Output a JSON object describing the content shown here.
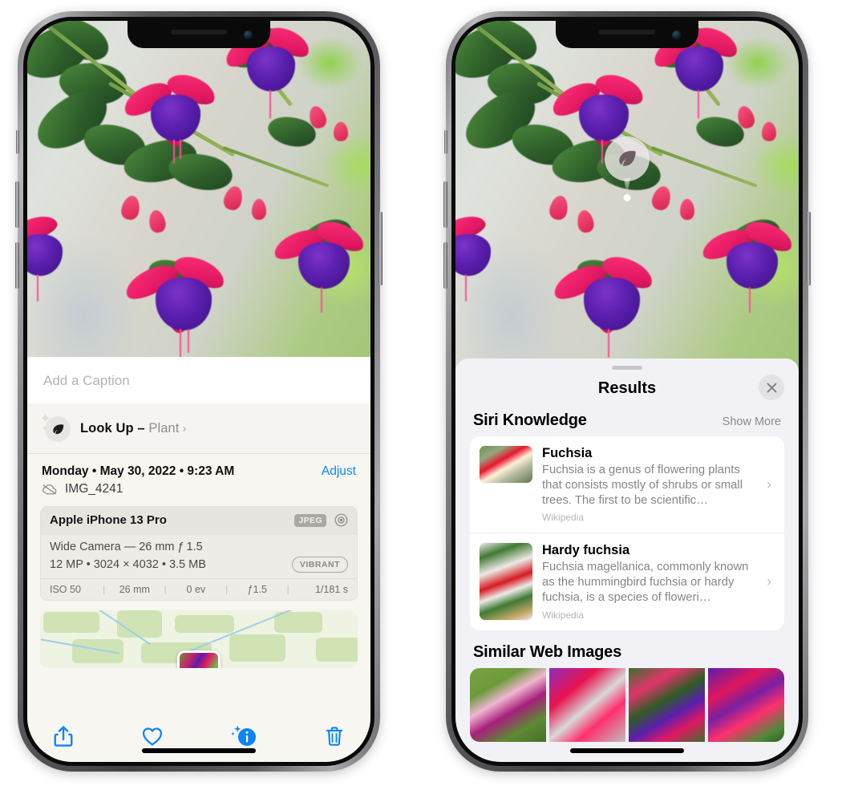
{
  "left_phone": {
    "caption_placeholder": "Add a Caption",
    "lookup": {
      "label": "Look Up",
      "dash": " – ",
      "subject": "Plant",
      "chevron": "›",
      "icon": "leaf-icon",
      "sparkle": "✦"
    },
    "date_line": "Monday • May 30, 2022 • 9:23 AM",
    "adjust_label": "Adjust",
    "file_name": "IMG_4241",
    "cloud_icon": "icloud-slash-icon",
    "exif": {
      "device": "Apple iPhone 13 Pro",
      "format_badge": "JPEG",
      "aperture_icon": "aperture-icon",
      "lens_line": "Wide Camera — 26 mm ƒ 1.5",
      "size_line": "12 MP • 3024 × 4032 • 3.5 MB",
      "style_badge": "VIBRANT",
      "stats": [
        "ISO 50",
        "26 mm",
        "0 ev",
        "ƒ1.5",
        "1/181 s"
      ],
      "divider": "|"
    },
    "map": {
      "name": "location-map-thumbnail"
    },
    "toolbar": [
      {
        "name": "share-button",
        "icon": "share-icon"
      },
      {
        "name": "favorite-button",
        "icon": "heart-icon"
      },
      {
        "name": "info-button",
        "icon": "info-sparkle-icon"
      },
      {
        "name": "delete-button",
        "icon": "trash-icon"
      }
    ],
    "accent_color": "#0a84ff"
  },
  "right_phone": {
    "vlu_badge": {
      "icon": "leaf-icon",
      "name": "visual-look-up-badge"
    },
    "sheet": {
      "title": "Results",
      "close_icon": "close-icon",
      "sections": [
        {
          "title": "Siri Knowledge",
          "action": "Show More",
          "cards": [
            {
              "title": "Fuchsia",
              "description": "Fuchsia is a genus of flowering plants that consists mostly of shrubs or small trees. The first to be scientific…",
              "source": "Wikipedia",
              "thumb": "fuchsia-red-flowers-thumbnail"
            },
            {
              "title": "Hardy fuchsia",
              "description": "Fuchsia magellanica, commonly known as the hummingbird fuchsia or hardy fuchsia, is a species of floweri…",
              "source": "Wikipedia",
              "thumb": "hardy-fuchsia-specimen-thumbnail"
            }
          ]
        },
        {
          "title": "Similar Web Images",
          "images": [
            "web-image-1",
            "web-image-2",
            "web-image-3",
            "web-image-4"
          ]
        }
      ]
    }
  }
}
